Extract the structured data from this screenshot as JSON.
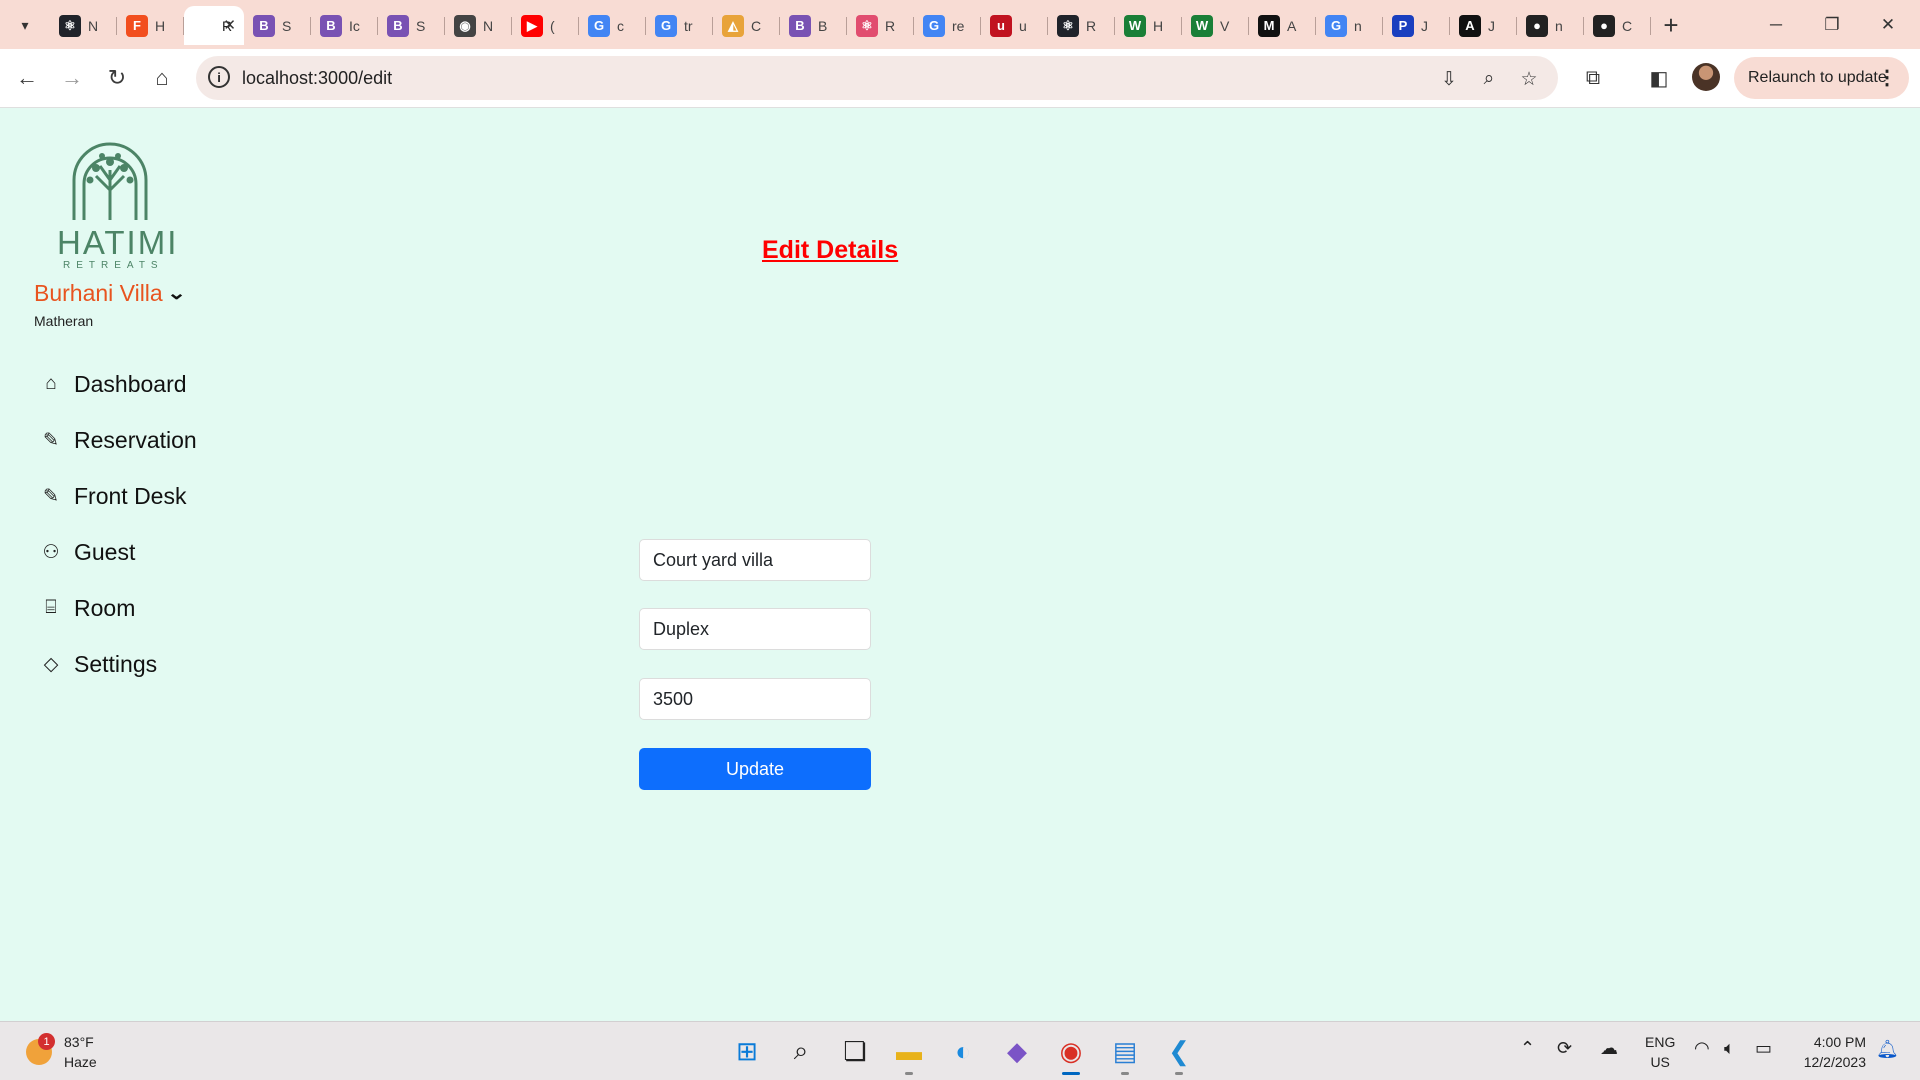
{
  "browser": {
    "tabs": [
      {
        "icon": "react-icon",
        "title": "N",
        "color": "#20232a",
        "glyph": "⚛"
      },
      {
        "icon": "figma-icon",
        "title": "H",
        "color": "#f24e1e",
        "glyph": "F"
      },
      {
        "icon": "page-icon",
        "title": "R",
        "color": "#ffffff",
        "glyph": "",
        "active": true
      },
      {
        "icon": "bootstrap-icon",
        "title": "S",
        "color": "#7952b3",
        "glyph": "B"
      },
      {
        "icon": "bootstrap-icon",
        "title": "Ic",
        "color": "#7952b3",
        "glyph": "B"
      },
      {
        "icon": "bootstrap-icon",
        "title": "S",
        "color": "#7952b3",
        "glyph": "B"
      },
      {
        "icon": "circle-icon",
        "title": "N",
        "color": "#444444",
        "glyph": "◉"
      },
      {
        "icon": "youtube-icon",
        "title": "(",
        "color": "#ff0000",
        "glyph": "▶"
      },
      {
        "icon": "google-icon",
        "title": "c",
        "color": "#4285f4",
        "glyph": "G"
      },
      {
        "icon": "google-icon",
        "title": "tr",
        "color": "#4285f4",
        "glyph": "G"
      },
      {
        "icon": "codepen-icon",
        "title": "C",
        "color": "#e8a33a",
        "glyph": "◭"
      },
      {
        "icon": "bootstrap-icon",
        "title": "B",
        "color": "#7952b3",
        "glyph": "B"
      },
      {
        "icon": "react-icon",
        "title": "R",
        "color": "#e14d6f",
        "glyph": "⚛"
      },
      {
        "icon": "google-icon",
        "title": "re",
        "color": "#4285f4",
        "glyph": "G"
      },
      {
        "icon": "udemy-icon",
        "title": "u",
        "color": "#c1121f",
        "glyph": "u"
      },
      {
        "icon": "react-icon",
        "title": "R",
        "color": "#20232a",
        "glyph": "⚛"
      },
      {
        "icon": "w-icon",
        "title": "H",
        "color": "#1a7f37",
        "glyph": "W"
      },
      {
        "icon": "w-icon",
        "title": "V",
        "color": "#1a7f37",
        "glyph": "W"
      },
      {
        "icon": "m-icon",
        "title": "A",
        "color": "#111111",
        "glyph": "M"
      },
      {
        "icon": "google-icon",
        "title": "n",
        "color": "#4285f4",
        "glyph": "G"
      },
      {
        "icon": "paypal-icon",
        "title": "J",
        "color": "#1a3fbf",
        "glyph": "P"
      },
      {
        "icon": "atlas-icon",
        "title": "J",
        "color": "#111111",
        "glyph": "A"
      },
      {
        "icon": "github-icon",
        "title": "n",
        "color": "#222222",
        "glyph": "●"
      },
      {
        "icon": "github-icon",
        "title": "C",
        "color": "#222222",
        "glyph": "●"
      }
    ],
    "url": "localhost:3000/edit",
    "relaunch_label": "Relaunch to update"
  },
  "sidebar": {
    "brand": "HATIMI",
    "brand_sub": "RETREATS",
    "property_name": "Burhani Villa",
    "property_location": "Matheran",
    "items": [
      {
        "label": "Dashboard",
        "icon": "home-icon",
        "glyph": "⌂"
      },
      {
        "label": "Reservation",
        "icon": "edit-icon",
        "glyph": "✎"
      },
      {
        "label": "Front Desk",
        "icon": "edit-icon",
        "glyph": "✎"
      },
      {
        "label": "Guest",
        "icon": "user-icon",
        "glyph": "⚇"
      },
      {
        "label": "Room",
        "icon": "door-icon",
        "glyph": "⌸"
      },
      {
        "label": "Settings",
        "icon": "tag-icon",
        "glyph": "◇"
      }
    ]
  },
  "main": {
    "heading": "Edit Details",
    "fields": {
      "room_name": "Court yard villa",
      "room_type": "Duplex",
      "price": "3500"
    },
    "update_label": "Update"
  },
  "taskbar": {
    "temperature": "83°F",
    "condition": "Haze",
    "weather_badge": "1",
    "lang_line1": "ENG",
    "lang_line2": "US",
    "time": "4:00 PM",
    "date": "12/2/2023"
  },
  "colors": {
    "page_background": "#e3faf2",
    "accent_orange": "#e8541f",
    "heading_red": "#ff0000",
    "button_blue": "#0d6efd",
    "brand_green": "#4c8466",
    "tab_strip": "#f8dcd4"
  }
}
